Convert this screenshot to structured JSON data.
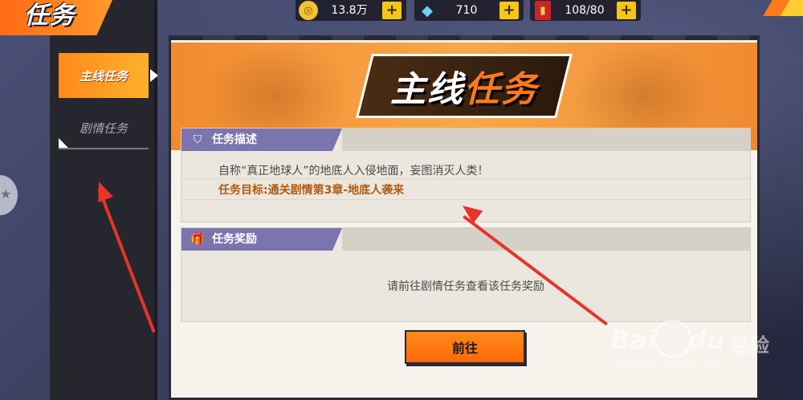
{
  "header": {
    "title": "任务"
  },
  "currencies": [
    {
      "icon": "gold-coin-icon",
      "value": "13.8万",
      "plus": "+"
    },
    {
      "icon": "diamond-icon",
      "value": "710",
      "plus": "+"
    },
    {
      "icon": "energy-card-icon",
      "value": "108/80",
      "plus": "+"
    }
  ],
  "sidebar": {
    "tabs": [
      {
        "label": "主线任务",
        "active": true
      },
      {
        "label": "剧情任务",
        "active": false
      }
    ]
  },
  "dialog": {
    "banner_title_part1": "主线",
    "banner_title_part2": "任务",
    "description": {
      "title": "任务描述",
      "icon": "shield-icon",
      "text": "自称“真正地球人”的地底人入侵地面，妄图消灭人类！",
      "goal": "任务目标:通关剧情第3章-地底人袭来"
    },
    "reward": {
      "title": "任务奖励",
      "icon": "gift-icon",
      "text": "请前往剧情任务查看该任务奖励"
    },
    "go_button": "前往"
  },
  "watermark": {
    "logo": "Bai",
    "logo_suffix": "du",
    "sub": "经验",
    "url": "jingyan.baidu.com"
  },
  "colors": {
    "accent": "#ff7a1a",
    "section_header": "#7c74ae",
    "goal_text": "#b05a12",
    "annotation": "#e8342a"
  }
}
